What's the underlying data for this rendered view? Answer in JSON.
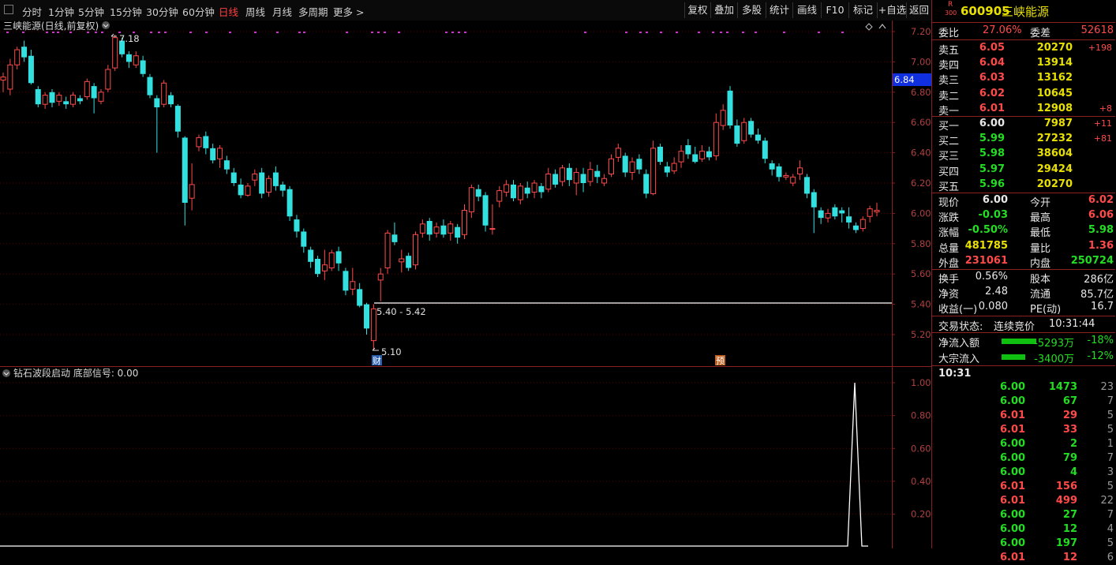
{
  "toolbar": {
    "periods": [
      "分时",
      "1分钟",
      "5分钟",
      "15分钟",
      "30分钟",
      "60分钟",
      "日线",
      "周线",
      "月线",
      "多周期",
      "更多 >"
    ],
    "active_period": "日线",
    "buttons": [
      "复权",
      "叠加",
      "多股",
      "统计",
      "画线",
      "F10",
      "标记",
      "+自选",
      "返回"
    ]
  },
  "main_chart": {
    "title": "三峡能源(日线,前复权)",
    "high_label": "7.18",
    "low_label": "5.10",
    "range_label": "5.40 - 5.42",
    "current_price_tag": "6.84",
    "y_ticks": [
      "7.20",
      "7.00",
      "6.80",
      "6.60",
      "6.40",
      "6.20",
      "6.00",
      "5.80",
      "5.60",
      "5.40",
      "5.20"
    ],
    "badge_cai": "财",
    "badge_yu": "预"
  },
  "indicator": {
    "title": "钻石波段启动 底部信号: 0.00",
    "y_ticks": [
      "1.00",
      "0.80",
      "0.60",
      "0.40",
      "0.20"
    ]
  },
  "colors": {
    "up": "#ff4a4a",
    "down": "#33e0e0",
    "grid": "#5a0000",
    "marker": "#cc33cc"
  },
  "chart_data": {
    "type": "candlestick",
    "ylim": [
      5.1,
      7.25
    ],
    "candles": [
      [
        6.88,
        6.9,
        6.8,
        6.93
      ],
      [
        6.82,
        6.98,
        6.78,
        7.02
      ],
      [
        6.98,
        7.08,
        6.95,
        7.1
      ],
      [
        7.1,
        7.03,
        7.0,
        7.14
      ],
      [
        7.04,
        6.86,
        6.85,
        7.08
      ],
      [
        6.82,
        6.72,
        6.7,
        6.84
      ],
      [
        6.72,
        6.78,
        6.69,
        6.8
      ],
      [
        6.8,
        6.73,
        6.7,
        6.82
      ],
      [
        6.74,
        6.78,
        6.71,
        6.8
      ],
      [
        6.74,
        6.72,
        6.69,
        6.77
      ],
      [
        6.72,
        6.78,
        6.7,
        6.8
      ],
      [
        6.76,
        6.74,
        6.72,
        6.78
      ],
      [
        6.77,
        6.87,
        6.75,
        6.89
      ],
      [
        6.84,
        6.76,
        6.66,
        6.86
      ],
      [
        6.74,
        6.8,
        6.72,
        6.82
      ],
      [
        6.82,
        6.95,
        6.8,
        6.98
      ],
      [
        6.96,
        7.16,
        6.94,
        7.18
      ],
      [
        7.14,
        7.05,
        7.03,
        7.16
      ],
      [
        7.05,
        7.0,
        6.96,
        7.07
      ],
      [
        6.98,
        7.04,
        6.96,
        7.07
      ],
      [
        7.01,
        6.92,
        6.9,
        7.04
      ],
      [
        6.9,
        6.78,
        6.76,
        6.92
      ],
      [
        6.76,
        6.7,
        6.4,
        6.78
      ],
      [
        6.72,
        6.86,
        6.7,
        6.88
      ],
      [
        6.78,
        6.72,
        6.7,
        6.8
      ],
      [
        6.71,
        6.54,
        6.5,
        6.72
      ],
      [
        6.5,
        6.07,
        5.92,
        6.51
      ],
      [
        6.1,
        6.19,
        6.02,
        6.33
      ],
      [
        6.44,
        6.5,
        6.41,
        6.52
      ],
      [
        6.51,
        6.43,
        6.39,
        6.54
      ],
      [
        6.43,
        6.35,
        6.33,
        6.46
      ],
      [
        6.36,
        6.43,
        6.3,
        6.45
      ],
      [
        6.35,
        6.29,
        6.26,
        6.38
      ],
      [
        6.27,
        6.2,
        6.18,
        6.3
      ],
      [
        6.19,
        6.12,
        6.1,
        6.23
      ],
      [
        6.12,
        6.18,
        6.11,
        6.2
      ],
      [
        6.22,
        6.26,
        6.18,
        6.29
      ],
      [
        6.27,
        6.13,
        6.1,
        6.3
      ],
      [
        6.14,
        6.23,
        6.11,
        6.25
      ],
      [
        6.27,
        6.18,
        6.15,
        6.31
      ],
      [
        6.19,
        6.15,
        6.11,
        6.21
      ],
      [
        6.16,
        5.98,
        5.95,
        6.18
      ],
      [
        5.96,
        5.88,
        5.84,
        5.99
      ],
      [
        5.88,
        5.78,
        5.74,
        5.9
      ],
      [
        5.76,
        5.68,
        5.64,
        5.78
      ],
      [
        5.7,
        5.6,
        5.58,
        5.72
      ],
      [
        5.62,
        5.66,
        5.56,
        5.76
      ],
      [
        5.64,
        5.74,
        5.62,
        5.76
      ],
      [
        5.75,
        5.67,
        5.62,
        5.78
      ],
      [
        5.62,
        5.49,
        5.46,
        5.64
      ],
      [
        5.5,
        5.55,
        5.46,
        5.64
      ],
      [
        5.5,
        5.39,
        5.38,
        5.54
      ],
      [
        5.4,
        5.24,
        5.2,
        5.41
      ],
      [
        5.16,
        5.37,
        5.1,
        5.4
      ],
      [
        5.56,
        5.6,
        5.42,
        5.64
      ],
      [
        5.64,
        5.87,
        5.6,
        5.89
      ],
      [
        5.86,
        5.81,
        5.79,
        5.94
      ],
      [
        5.68,
        5.7,
        5.61,
        5.76
      ],
      [
        5.72,
        5.64,
        5.62,
        5.74
      ],
      [
        5.66,
        5.86,
        5.63,
        5.88
      ],
      [
        5.87,
        5.93,
        5.84,
        5.96
      ],
      [
        5.95,
        5.86,
        5.82,
        5.97
      ],
      [
        5.87,
        5.91,
        5.84,
        5.94
      ],
      [
        5.92,
        5.86,
        5.84,
        5.96
      ],
      [
        5.87,
        5.93,
        5.82,
        5.95
      ],
      [
        5.91,
        5.84,
        5.8,
        5.93
      ],
      [
        5.86,
        6.02,
        5.83,
        6.06
      ],
      [
        6.01,
        6.17,
        5.97,
        6.19
      ],
      [
        6.16,
        6.11,
        6.08,
        6.19
      ],
      [
        6.12,
        5.92,
        5.88,
        6.14
      ],
      [
        5.9,
        5.9,
        5.86,
        6.06
      ],
      [
        6.08,
        6.15,
        6.04,
        6.18
      ],
      [
        6.14,
        6.19,
        6.11,
        6.22
      ],
      [
        6.19,
        6.1,
        6.08,
        6.22
      ],
      [
        6.09,
        6.18,
        6.06,
        6.2
      ],
      [
        6.17,
        6.13,
        6.1,
        6.21
      ],
      [
        6.14,
        6.2,
        6.1,
        6.22
      ],
      [
        6.18,
        6.14,
        6.1,
        6.2
      ],
      [
        6.16,
        6.26,
        6.14,
        6.3
      ],
      [
        6.26,
        6.19,
        6.17,
        6.29
      ],
      [
        6.21,
        6.3,
        6.18,
        6.32
      ],
      [
        6.3,
        6.22,
        6.18,
        6.33
      ],
      [
        6.2,
        6.27,
        6.12,
        6.3
      ],
      [
        6.26,
        6.2,
        6.14,
        6.3
      ],
      [
        6.21,
        6.29,
        6.18,
        6.34
      ],
      [
        6.28,
        6.24,
        6.2,
        6.32
      ],
      [
        6.2,
        6.23,
        6.18,
        6.26
      ],
      [
        6.26,
        6.36,
        6.24,
        6.39
      ],
      [
        6.37,
        6.43,
        6.34,
        6.46
      ],
      [
        6.38,
        6.27,
        6.24,
        6.4
      ],
      [
        6.27,
        6.34,
        6.22,
        6.37
      ],
      [
        6.36,
        6.29,
        6.26,
        6.39
      ],
      [
        6.26,
        6.13,
        6.1,
        6.29
      ],
      [
        6.13,
        6.43,
        6.12,
        6.48
      ],
      [
        6.44,
        6.34,
        6.32,
        6.46
      ],
      [
        6.31,
        6.27,
        6.24,
        6.34
      ],
      [
        6.28,
        6.33,
        6.26,
        6.37
      ],
      [
        6.34,
        6.41,
        6.3,
        6.45
      ],
      [
        6.45,
        6.39,
        6.36,
        6.49
      ],
      [
        6.39,
        6.34,
        6.33,
        6.44
      ],
      [
        6.36,
        6.41,
        6.34,
        6.45
      ],
      [
        6.41,
        6.37,
        6.35,
        6.44
      ],
      [
        6.38,
        6.6,
        6.35,
        6.66
      ],
      [
        6.58,
        6.68,
        6.55,
        6.72
      ],
      [
        6.81,
        6.58,
        6.56,
        6.84
      ],
      [
        6.58,
        6.46,
        6.44,
        6.62
      ],
      [
        6.48,
        6.6,
        6.46,
        6.63
      ],
      [
        6.61,
        6.52,
        6.5,
        6.63
      ],
      [
        6.52,
        6.48,
        6.46,
        6.56
      ],
      [
        6.48,
        6.36,
        6.33,
        6.5
      ],
      [
        6.33,
        6.29,
        6.25,
        6.35
      ],
      [
        6.31,
        6.24,
        6.21,
        6.33
      ],
      [
        6.24,
        6.25,
        6.22,
        6.27
      ],
      [
        6.2,
        6.24,
        6.18,
        6.26
      ],
      [
        6.26,
        6.3,
        6.22,
        6.35
      ],
      [
        6.24,
        6.13,
        6.1,
        6.26
      ],
      [
        6.14,
        6.04,
        5.87,
        6.16
      ],
      [
        6.02,
        5.97,
        5.93,
        6.04
      ],
      [
        5.97,
        6.0,
        5.94,
        6.03
      ],
      [
        6.04,
        5.98,
        5.96,
        6.06
      ],
      [
        6.02,
        6.0,
        5.94,
        6.04
      ],
      [
        5.98,
        5.94,
        5.9,
        6.04
      ],
      [
        5.92,
        5.89,
        5.87,
        5.94
      ],
      [
        5.9,
        5.96,
        5.88,
        5.98
      ],
      [
        5.98,
        6.03,
        5.94,
        6.05
      ],
      [
        6.01,
        6.02,
        5.98,
        6.07
      ]
    ],
    "signal": {
      "values": [
        0.0,
        0.0,
        1.0,
        0.0,
        0.0
      ],
      "peak_value": 1.0
    }
  },
  "panel": {
    "code": "600905",
    "name": "三峡能源",
    "tag": "R",
    "tag_sub": "300",
    "wei_bi_label": "委比",
    "wei_bi": "27.06%",
    "wei_cha_label": "委差",
    "wei_cha": "52618",
    "asks": [
      {
        "label": "卖五",
        "price": "6.05",
        "vol": "20270",
        "chg": "+198"
      },
      {
        "label": "卖四",
        "price": "6.04",
        "vol": "13914",
        "chg": ""
      },
      {
        "label": "卖三",
        "price": "6.03",
        "vol": "13162",
        "chg": ""
      },
      {
        "label": "卖二",
        "price": "6.02",
        "vol": "10645",
        "chg": ""
      },
      {
        "label": "卖一",
        "price": "6.01",
        "vol": "12908",
        "chg": "+8"
      }
    ],
    "bids": [
      {
        "label": "买一",
        "price": "6.00",
        "vol": "7987",
        "chg": "+11"
      },
      {
        "label": "买二",
        "price": "5.99",
        "vol": "27232",
        "chg": "+81"
      },
      {
        "label": "买三",
        "price": "5.98",
        "vol": "38604",
        "chg": ""
      },
      {
        "label": "买四",
        "price": "5.97",
        "vol": "29424",
        "chg": ""
      },
      {
        "label": "买五",
        "price": "5.96",
        "vol": "20270",
        "chg": ""
      }
    ],
    "quote": [
      {
        "l1": "现价",
        "v1": "6.00",
        "c1": "white",
        "l2": "今开",
        "v2": "6.02",
        "c2": "red"
      },
      {
        "l1": "涨跌",
        "v1": "-0.03",
        "c1": "green",
        "l2": "最高",
        "v2": "6.06",
        "c2": "red"
      },
      {
        "l1": "涨幅",
        "v1": "-0.50%",
        "c1": "green",
        "l2": "最低",
        "v2": "5.98",
        "c2": "green"
      },
      {
        "l1": "总量",
        "v1": "481785",
        "c1": "yellow",
        "l2": "量比",
        "v2": "1.36",
        "c2": "red"
      },
      {
        "l1": "外盘",
        "v1": "231061",
        "c1": "red",
        "l2": "内盘",
        "v2": "250724",
        "c2": "green"
      }
    ],
    "fund": [
      {
        "l1": "换手",
        "v1": "0.56%",
        "l2": "股本",
        "v2": "286亿"
      },
      {
        "l1": "净资",
        "v1": "2.48",
        "l2": "流通",
        "v2": "85.7亿"
      },
      {
        "l1": "收益(一)",
        "v1": "0.080",
        "l2": "PE(动)",
        "v2": "16.7"
      }
    ],
    "trade_status_label": "交易状态:",
    "trade_status": "连续竞价",
    "trade_time": "10:31:44",
    "flows": [
      {
        "label": "净流入额",
        "value": "-5293万",
        "pct": "-18%",
        "bar": 0.8
      },
      {
        "label": "大宗流入",
        "value": "-3400万",
        "pct": "-12%",
        "bar": 0.55
      }
    ],
    "ticks_time": "10:31",
    "ticks": [
      {
        "p": "6.00",
        "v": "1473",
        "c": "green",
        "n": "23"
      },
      {
        "p": "6.00",
        "v": "67",
        "c": "green",
        "n": "7"
      },
      {
        "p": "6.01",
        "v": "29",
        "c": "red",
        "n": "5"
      },
      {
        "p": "6.01",
        "v": "33",
        "c": "red",
        "n": "5"
      },
      {
        "p": "6.00",
        "v": "2",
        "c": "green",
        "n": "1"
      },
      {
        "p": "6.00",
        "v": "79",
        "c": "green",
        "n": "7"
      },
      {
        "p": "6.00",
        "v": "4",
        "c": "green",
        "n": "3"
      },
      {
        "p": "6.01",
        "v": "156",
        "c": "red",
        "n": "5"
      },
      {
        "p": "6.01",
        "v": "499",
        "c": "red",
        "n": "22"
      },
      {
        "p": "6.00",
        "v": "27",
        "c": "green",
        "n": "7"
      },
      {
        "p": "6.00",
        "v": "12",
        "c": "green",
        "n": "4"
      },
      {
        "p": "6.00",
        "v": "197",
        "c": "green",
        "n": "5"
      },
      {
        "p": "6.01",
        "v": "12",
        "c": "red",
        "n": "6"
      }
    ]
  }
}
